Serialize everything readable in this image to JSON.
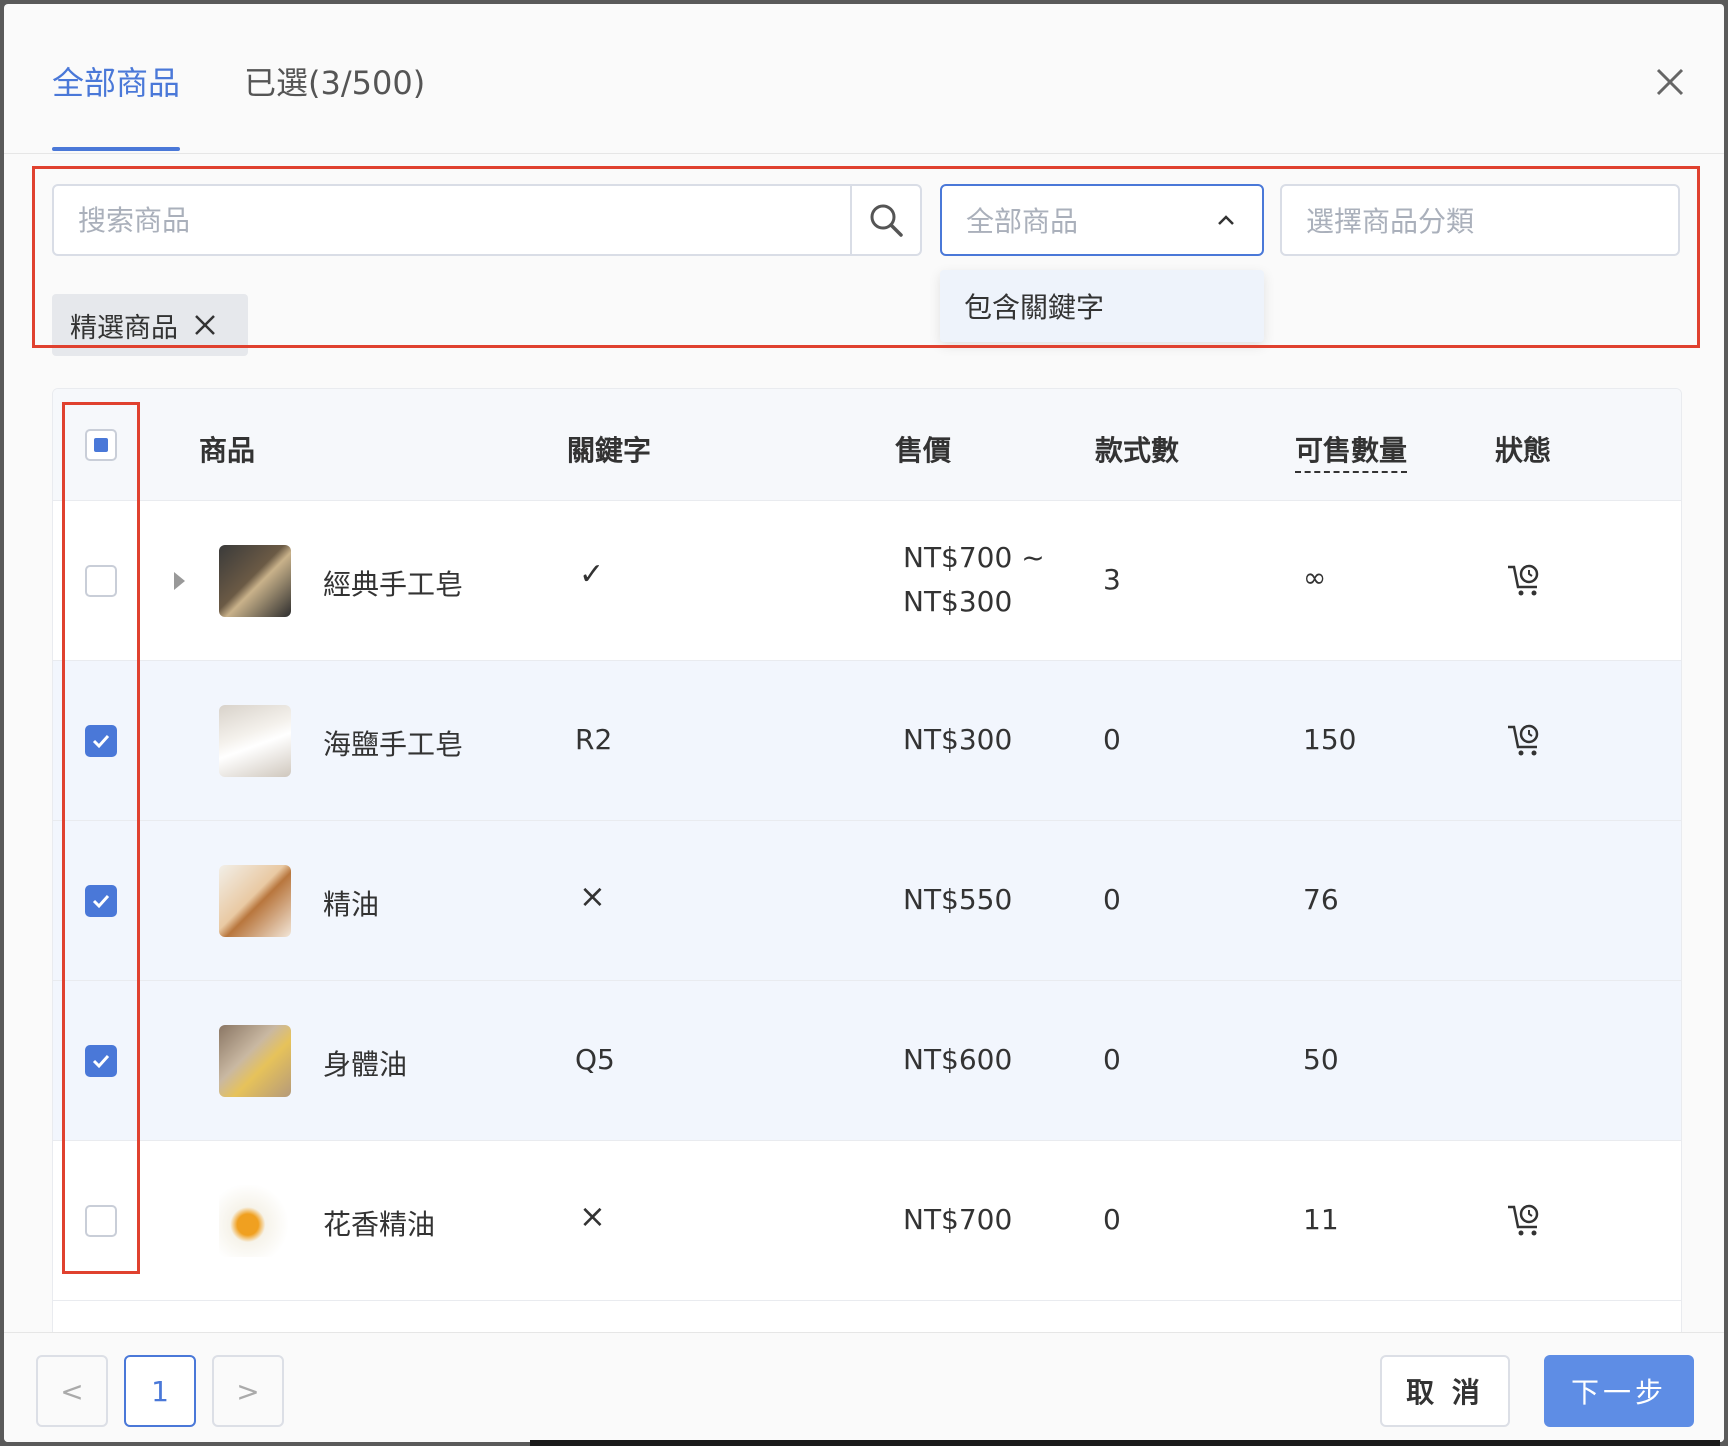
{
  "header": {
    "tab_all": "全部商品",
    "tab_selected": "已選(3/500)"
  },
  "filters": {
    "search_placeholder": "搜索商品",
    "select_placeholder": "全部商品",
    "category_placeholder": "選擇商品分類",
    "dropdown_option": "包含關鍵字",
    "tag_label": "精選商品"
  },
  "table": {
    "columns": {
      "product": "商品",
      "keyword": "關鍵字",
      "price": "售價",
      "variants": "款式數",
      "stock": "可售數量",
      "status": "狀態"
    },
    "rows": [
      {
        "name": "經典手工皂",
        "keyword": "✓",
        "price_line1": "NT$700 ~",
        "price_line2": "NT$300",
        "variants": "3",
        "stock": "∞",
        "checked": false,
        "has_cart": true,
        "expandable": true
      },
      {
        "name": "海鹽手工皂",
        "keyword": "R2",
        "price_line1": "NT$300",
        "price_line2": "",
        "variants": "0",
        "stock": "150",
        "checked": true,
        "has_cart": true,
        "expandable": false
      },
      {
        "name": "精油",
        "keyword": "×",
        "price_line1": "NT$550",
        "price_line2": "",
        "variants": "0",
        "stock": "76",
        "checked": true,
        "has_cart": false,
        "expandable": false
      },
      {
        "name": "身體油",
        "keyword": "Q5",
        "price_line1": "NT$600",
        "price_line2": "",
        "variants": "0",
        "stock": "50",
        "checked": true,
        "has_cart": false,
        "expandable": false
      },
      {
        "name": "花香精油",
        "keyword": "×",
        "price_line1": "NT$700",
        "price_line2": "",
        "variants": "0",
        "stock": "11",
        "checked": false,
        "has_cart": true,
        "expandable": false
      }
    ]
  },
  "pagination": {
    "prev": "<",
    "current": "1",
    "next": ">"
  },
  "footer": {
    "cancel_label": "取 消",
    "next_label": "下一步"
  },
  "colors": {
    "accent": "#4a78d8",
    "highlight": "#e0412f"
  }
}
